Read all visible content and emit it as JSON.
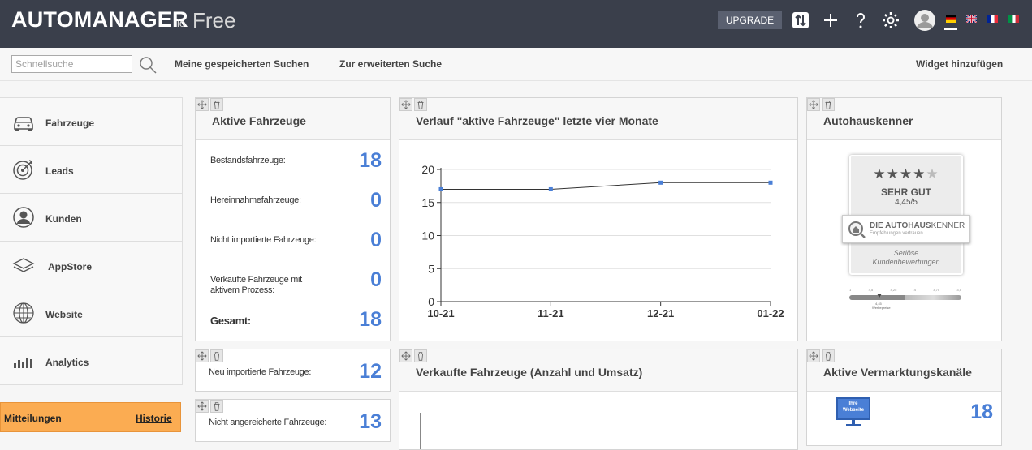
{
  "header": {
    "logo": "AUTOMANAGER",
    "logo_io": "io",
    "logo_free": "Free",
    "upgrade_label": "UPGRADE"
  },
  "subbar": {
    "search_placeholder": "Schnellsuche",
    "saved_searches": "Meine gespeicherten Suchen",
    "advanced_search": "Zur erweiterten Suche",
    "add_widget": "Widget hinzufügen"
  },
  "sidebar": {
    "items": [
      {
        "label": "Fahrzeuge",
        "icon": "car-icon"
      },
      {
        "label": "Leads",
        "icon": "target-icon"
      },
      {
        "label": "Kunden",
        "icon": "user-icon"
      },
      {
        "label": "AppStore",
        "icon": "layers-icon"
      },
      {
        "label": "Website",
        "icon": "globe-icon"
      },
      {
        "label": "Analytics",
        "icon": "bar-chart-icon"
      }
    ],
    "messages_label": "Mitteilungen",
    "history_label": "Historie"
  },
  "widgets": {
    "active": {
      "title": "Aktive Fahrzeuge",
      "rows": [
        {
          "label": "Bestandsfahrzeuge:",
          "value": "18"
        },
        {
          "label": "Hereinnahmefahrzeuge:",
          "value": "0"
        },
        {
          "label": "Nicht importierte Fahrzeuge:",
          "value": "0"
        },
        {
          "label": "Verkaufte Fahrzeuge mit aktivem Prozess:",
          "value": "0"
        },
        {
          "label": "Gesamt:",
          "value": "18"
        }
      ]
    },
    "imported": {
      "label": "Neu importierte Fahrzeuge:",
      "value": "12"
    },
    "not_enriched": {
      "label": "Nicht angereicherte Fahrzeuge:",
      "value": "13"
    },
    "trend": {
      "title": "Verlauf \"aktive Fahrzeuge\" letzte vier Monate"
    },
    "sold": {
      "title": "Verkaufte Fahrzeuge (Anzahl und Umsatz)"
    },
    "autohaus": {
      "title": "Autohauskenner",
      "rating_text": "SEHR GUT",
      "rating_value": "4,45/5",
      "brand_main": "DIE AUTOHAUS",
      "brand_suffix": "KENNER",
      "brand_sub": "Empfehlungen vertrauen",
      "tagline_1": "Seriöse",
      "tagline_2": "Kundenbewertungen",
      "stars": 4.45,
      "scale_ticks": [
        "1",
        "4,5",
        "4,25",
        "4",
        "3,75",
        "3,5"
      ],
      "scale_value": "4,45",
      "scale_caption": "Werbepreise"
    },
    "channels": {
      "title": "Aktive Vermarktungskanäle",
      "value": "18",
      "icon_text_1": "Ihre",
      "icon_text_2": "Webseite"
    }
  },
  "chart_data": {
    "type": "line",
    "title": "Verlauf \"aktive Fahrzeuge\" letzte vier Monate",
    "categories": [
      "10-21",
      "11-21",
      "12-21",
      "01-22"
    ],
    "values": [
      17,
      17,
      18,
      18
    ],
    "ylim": [
      0,
      20
    ],
    "yticks": [
      0,
      5,
      10,
      15,
      20
    ],
    "grid": true,
    "color": "#4a7fd6"
  },
  "colors": {
    "accent": "#4a7fd6",
    "topbar": "#3a3f4b",
    "messages": "#fbac52"
  }
}
